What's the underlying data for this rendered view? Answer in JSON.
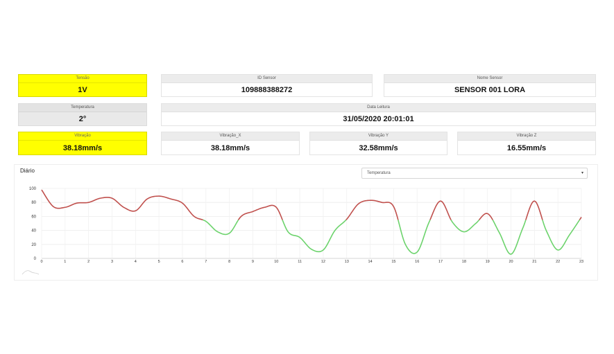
{
  "cards": {
    "tensao": {
      "label": "Tensão",
      "value": "1V"
    },
    "id_sensor": {
      "label": "ID Sensor",
      "value": "109888388272"
    },
    "nome_sensor": {
      "label": "Nome Sensor",
      "value": "SENSOR 001 LORA"
    },
    "temperatura": {
      "label": "Temperatura",
      "value": "2°"
    },
    "data_leitura": {
      "label": "Data Leitura",
      "value": "31/05/2020 20:01:01"
    },
    "vibracao": {
      "label": "Vibração",
      "value": "38.18mm/s"
    },
    "vibracao_x": {
      "label": "Vibração_X",
      "value": "38.18mm/s"
    },
    "vibracao_y": {
      "label": "Vibração Y",
      "value": "32.58mm/s"
    },
    "vibracao_z": {
      "label": "Vibração Z",
      "value": "16.55mm/s"
    }
  },
  "chart_panel": {
    "title": "Diário",
    "select_value": "Temperatura"
  },
  "colors": {
    "highlight": "#ffff00",
    "line_high": "#c0504d",
    "line_low": "#6cd36c"
  },
  "chart_data": {
    "type": "line",
    "x": [
      0,
      0.5,
      1,
      1.5,
      2,
      2.5,
      3,
      3.5,
      4,
      4.5,
      5,
      5.5,
      6,
      6.5,
      7,
      7.5,
      8,
      8.5,
      9,
      9.5,
      10,
      10.5,
      11,
      11.5,
      12,
      12.5,
      13,
      13.5,
      14,
      14.5,
      15,
      15.5,
      16,
      16.5,
      17,
      17.5,
      18,
      18.5,
      19,
      19.5,
      20,
      20.5,
      21,
      21.5,
      22,
      22.5,
      23
    ],
    "y": [
      98,
      74,
      73,
      79,
      80,
      86,
      86,
      73,
      68,
      85,
      89,
      85,
      79,
      60,
      53,
      38,
      36,
      60,
      67,
      73,
      73,
      38,
      30,
      13,
      12,
      40,
      56,
      78,
      83,
      80,
      74,
      20,
      9,
      51,
      82,
      52,
      38,
      50,
      64,
      37,
      6,
      43,
      82,
      40,
      12,
      34,
      59
    ],
    "threshold": 55,
    "xlim": [
      0,
      23
    ],
    "ylim": [
      0,
      100
    ],
    "xticks": [
      "0",
      "1",
      "2",
      "3",
      "4",
      "5",
      "6",
      "7",
      "8",
      "9",
      "10",
      "11",
      "12",
      "13",
      "14",
      "15",
      "16",
      "17",
      "18",
      "19",
      "20",
      "21",
      "22",
      "23"
    ],
    "yticks": [
      "0",
      "20",
      "40",
      "60",
      "80",
      "100"
    ],
    "grid": true
  }
}
